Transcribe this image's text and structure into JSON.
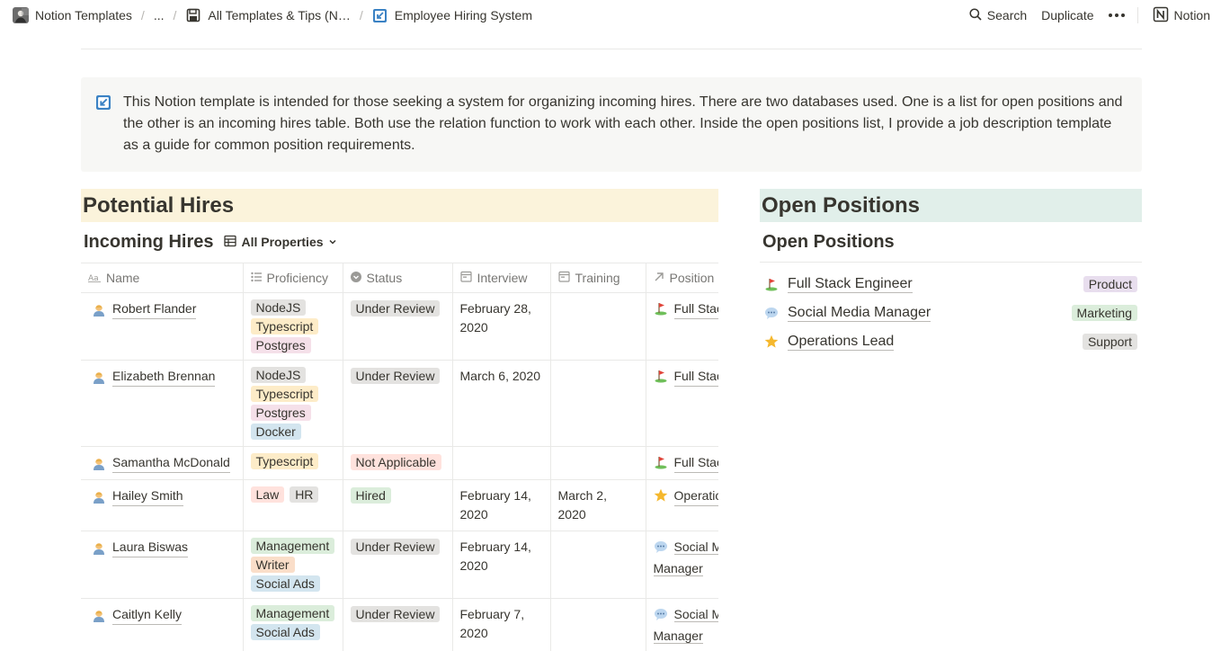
{
  "topbar": {
    "breadcrumbs": [
      {
        "label": "Notion Templates",
        "icon": "workspace-avatar-icon"
      },
      {
        "label": "..."
      },
      {
        "label": "All Templates & Tips (N…",
        "icon": "save-disk-icon"
      },
      {
        "label": "Employee Hiring System",
        "icon": "blue-arrow-icon"
      }
    ],
    "search_label": "Search",
    "duplicate_label": "Duplicate",
    "notion_label": "Notion"
  },
  "callout": {
    "text": "This Notion template is intended for those seeking a system for organizing incoming hires. There are two databases used. One is a list for open positions and the other is an incoming hires table. Both use the relation function to work with each other. Inside the open positions list, I provide a job description template as a guide for common position requirements."
  },
  "left": {
    "heading": "Potential Hires",
    "db_title": "Incoming Hires",
    "view_label": "All Properties",
    "columns": [
      "Name",
      "Proficiency",
      "Status",
      "Interview",
      "Training",
      "Position"
    ],
    "rows": [
      {
        "name": "Robert Flander",
        "tags": [
          [
            "NodeJS"
          ],
          [
            "Typescript"
          ],
          [
            "Postgres"
          ]
        ],
        "status": "Under Review",
        "interview": "February 28, 2020",
        "training": "",
        "position": "Full Stack Engineer",
        "position_icon": "golf-flag-icon"
      },
      {
        "name": "Elizabeth Brennan",
        "tags": [
          [
            "NodeJS"
          ],
          [
            "Typescript"
          ],
          [
            "Postgres"
          ],
          [
            "Docker"
          ]
        ],
        "status": "Under Review",
        "interview": "March 6, 2020",
        "training": "",
        "position": "Full Stack Engineer",
        "position_icon": "golf-flag-icon"
      },
      {
        "name": "Samantha McDonald",
        "tags": [
          [
            "Typescript"
          ]
        ],
        "status": "Not Applicable",
        "interview": "",
        "training": "",
        "position": "Full Stack Engineer",
        "position_icon": "golf-flag-icon"
      },
      {
        "name": "Hailey Smith",
        "tags": [
          [
            "Law",
            "HR"
          ]
        ],
        "status": "Hired",
        "interview": "February 14, 2020",
        "training": "March 2, 2020",
        "position": "Operations Lead",
        "position_icon": "star-icon"
      },
      {
        "name": "Laura Biswas",
        "tags": [
          [
            "Management"
          ],
          [
            "Writer"
          ],
          [
            "Social Ads"
          ]
        ],
        "status": "Under Review",
        "interview": "February 14, 2020",
        "training": "",
        "position": "Social Media Manager",
        "position_icon": "speech-bubble-icon"
      },
      {
        "name": "Caitlyn Kelly",
        "tags": [
          [
            "Management"
          ],
          [
            "Social Ads"
          ]
        ],
        "status": "Under Review",
        "interview": "February 7, 2020",
        "training": "",
        "position": "Social Media Manager",
        "position_icon": "speech-bubble-icon"
      }
    ]
  },
  "right": {
    "heading": "Open Positions",
    "list_title": "Open Positions",
    "items": [
      {
        "title": "Full Stack Engineer",
        "tag": "Product",
        "icon": "golf-flag-icon"
      },
      {
        "title": "Social Media Manager",
        "tag": "Marketing",
        "icon": "speech-bubble-icon"
      },
      {
        "title": "Operations Lead",
        "tag": "Support",
        "icon": "star-icon"
      }
    ]
  },
  "colors": {
    "text": "#37352f",
    "muted": "#787774",
    "callout_bg": "#f7f7f5",
    "potential_hires_bg": "#fbf3db",
    "open_positions_bg": "#e1efea",
    "tag_gray": "#e3e2e0",
    "tag_yellow": "#fdecc8",
    "tag_pink": "#f5e0e9",
    "tag_blue": "#d3e5ef",
    "tag_red": "#ffe2dd",
    "tag_green": "#dbeddb",
    "tag_orange": "#fadec9",
    "tag_purple": "#e8deee"
  }
}
